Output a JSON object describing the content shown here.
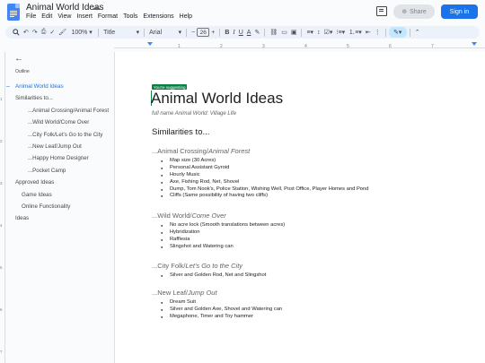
{
  "app": {
    "title": "Animal World Ideas",
    "menu": [
      "File",
      "Edit",
      "View",
      "Insert",
      "Format",
      "Tools",
      "Extensions",
      "Help"
    ],
    "share_label": "Share",
    "signin_label": "Sign in"
  },
  "toolbar": {
    "zoom": "100%",
    "style": "Title",
    "font": "Arial",
    "font_size": "26",
    "minus": "−",
    "plus": "+"
  },
  "ruler": {
    "ticks": [
      "1",
      "2",
      "3",
      "4",
      "5",
      "6",
      "7"
    ]
  },
  "sidebar": {
    "label": "Outline",
    "items": [
      {
        "label": "Animal World Ideas",
        "level": 1,
        "active": true
      },
      {
        "label": "Similarities to...",
        "level": 1
      },
      {
        "label": "...Animal Crossing/Animal Forest",
        "level": 3
      },
      {
        "label": "...Wild World/Come Over",
        "level": 3
      },
      {
        "label": "...City Folk/Let's Go to the City",
        "level": 3
      },
      {
        "label": "...New Leaf/Jump Out",
        "level": 3
      },
      {
        "label": "...Happy Home Designer",
        "level": 3
      },
      {
        "label": "...Pocket Camp",
        "level": 3
      },
      {
        "label": "Approved Ideas",
        "level": 1
      },
      {
        "label": "Game Ideas",
        "level": 2
      },
      {
        "label": "Online Functionality",
        "level": 2
      },
      {
        "label": "Ideas",
        "level": 1
      }
    ]
  },
  "document": {
    "suggest_badge": "You're suggesting",
    "title": "Animal World Ideas",
    "subtitle": "full name Animal World: Village Life",
    "heading": "Similarities to...",
    "sections": [
      {
        "prefix": "...Animal Crossing/",
        "italic": "Animal Forest",
        "bullets": [
          "Map size (30 Acres)",
          "Personal Assistant Gyroid",
          "Hourly Music",
          "Axe, Fishing Rod, Net, Shovel",
          "Dump, Tom Nook's, Police Station, Wishing Well, Post Office, Player Homes and Pond",
          "Cliffs (Same possibility of having two cliffs)"
        ]
      },
      {
        "prefix": "...Wild World/",
        "italic": "Come Over",
        "bullets": [
          "No acre lock (Smooth translations between acres)",
          "Hybridization",
          "Rafflesia",
          "Slingshot and Watering can"
        ]
      },
      {
        "prefix": "...City Folk/",
        "italic": "Let's Go to the City",
        "bullets": [
          "Silver and Golden Rod, Net and Slingshot"
        ]
      },
      {
        "prefix": "...New Leaf/",
        "italic": "Jump Out",
        "bullets": [
          "Dream Suit",
          "Silver and Golden Axe, Shovel and Watering can",
          "Megaphone, Timer and Toy hammer"
        ]
      }
    ]
  }
}
